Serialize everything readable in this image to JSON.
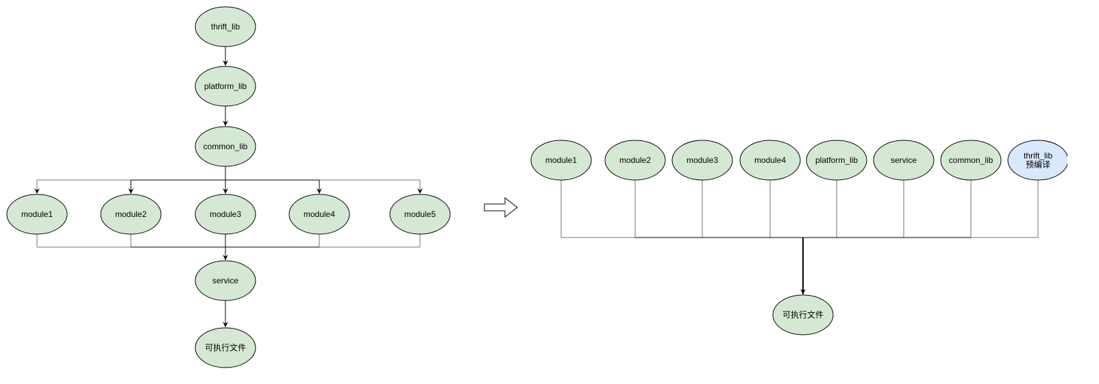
{
  "colors": {
    "node_fill": "#d5e8d4",
    "node_fill_highlight": "#dae8fc",
    "node_stroke": "#000000",
    "edge": "#000000",
    "edge_muted": "#707070"
  },
  "left_diagram": {
    "name": "before",
    "nodes": [
      {
        "id": "thrift_lib",
        "label": [
          "thrift_lib"
        ]
      },
      {
        "id": "platform_lib",
        "label": [
          "platform_lib"
        ]
      },
      {
        "id": "common_lib",
        "label": [
          "common_lib"
        ]
      },
      {
        "id": "module1",
        "label": [
          "module1"
        ]
      },
      {
        "id": "module2",
        "label": [
          "module2"
        ]
      },
      {
        "id": "module3",
        "label": [
          "module3"
        ]
      },
      {
        "id": "module4",
        "label": [
          "module4"
        ]
      },
      {
        "id": "module5",
        "label": [
          "module5"
        ]
      },
      {
        "id": "service",
        "label": [
          "service"
        ]
      },
      {
        "id": "executable",
        "label": [
          "可执行文件"
        ]
      }
    ],
    "edges": [
      [
        "thrift_lib",
        "platform_lib"
      ],
      [
        "platform_lib",
        "common_lib"
      ],
      [
        "common_lib",
        "module1"
      ],
      [
        "common_lib",
        "module2"
      ],
      [
        "common_lib",
        "module3"
      ],
      [
        "common_lib",
        "module4"
      ],
      [
        "common_lib",
        "module5"
      ],
      [
        "module1",
        "service"
      ],
      [
        "module2",
        "service"
      ],
      [
        "module3",
        "service"
      ],
      [
        "module4",
        "service"
      ],
      [
        "module5",
        "service"
      ],
      [
        "service",
        "executable"
      ]
    ]
  },
  "transition_arrow": "hollow-right-arrow",
  "right_diagram": {
    "name": "after",
    "nodes": [
      {
        "id": "module1",
        "label": [
          "module1"
        ]
      },
      {
        "id": "module2",
        "label": [
          "module2"
        ]
      },
      {
        "id": "module3",
        "label": [
          "module3"
        ]
      },
      {
        "id": "module4",
        "label": [
          "module4"
        ]
      },
      {
        "id": "platform_lib",
        "label": [
          "platform_lib"
        ]
      },
      {
        "id": "service",
        "label": [
          "service"
        ]
      },
      {
        "id": "common_lib",
        "label": [
          "common_lib"
        ]
      },
      {
        "id": "thrift_lib_precompiled",
        "label": [
          "thrift_lib",
          "预编译"
        ],
        "highlight": true
      },
      {
        "id": "executable",
        "label": [
          "可执行文件"
        ]
      }
    ],
    "edges": [
      [
        "module1",
        "executable"
      ],
      [
        "module2",
        "executable"
      ],
      [
        "module3",
        "executable"
      ],
      [
        "module4",
        "executable"
      ],
      [
        "platform_lib",
        "executable"
      ],
      [
        "service",
        "executable"
      ],
      [
        "common_lib",
        "executable"
      ],
      [
        "thrift_lib_precompiled",
        "executable"
      ]
    ]
  }
}
